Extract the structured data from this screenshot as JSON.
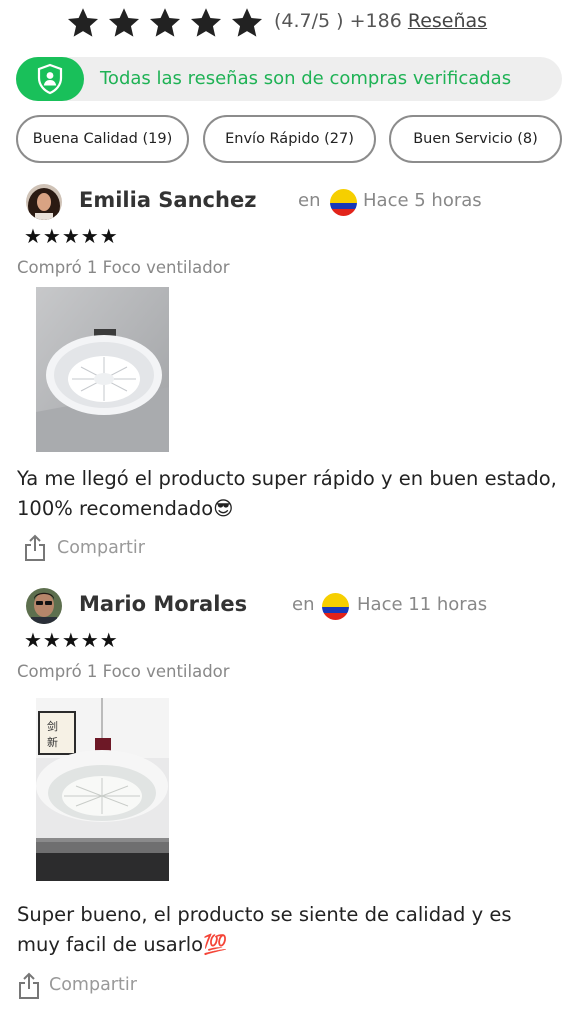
{
  "rating": {
    "stars_filled": 5,
    "score_text": "(4.7/5 )",
    "count_text": "+186",
    "reviews_link": "Reseñas"
  },
  "verified_banner": {
    "text": "Todas las reseñas son de compras verificadas",
    "accent": "#19c05a"
  },
  "tags": [
    {
      "label": "Buena Calidad (19)"
    },
    {
      "label": "Envío Rápido (27)"
    },
    {
      "label": "Buen Servicio (8)"
    }
  ],
  "reviews": [
    {
      "name": "Emilia Sanchez",
      "location_prefix": "en",
      "country_flag": "colombia-flag-icon",
      "time": "Hace 5 horas",
      "stars": "★★★★★",
      "purchase": "Compró 1 Foco ventilador",
      "text": "Ya me llegó el producto super rápido y en buen estado, 100% recomendado😎",
      "share_label": "Compartir"
    },
    {
      "name": "Mario Morales",
      "location_prefix": "en",
      "country_flag": "colombia-flag-icon",
      "time": "Hace 11 horas",
      "stars": "★★★★★",
      "purchase": "Compró 1 Foco ventilador",
      "text": "Super bueno, el producto se siente de calidad y es muy facil de usarlo💯",
      "share_label": "Compartir"
    }
  ]
}
